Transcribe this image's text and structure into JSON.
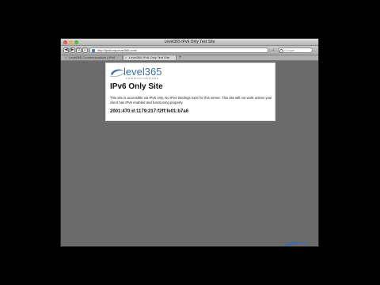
{
  "window": {
    "title": "Level365 IPv6 Only Test Site"
  },
  "toolbar": {
    "url": "http://ipv6only.level365.com/",
    "search_placeholder": "Google",
    "go_label": "→"
  },
  "tabs": [
    {
      "label": "Level365 Communications | IPv6"
    },
    {
      "label": "Level365 IPv6 Only Test Site"
    }
  ],
  "page": {
    "logo_text": "level365",
    "logo_subtext": "communications",
    "title": "IPv6 Only Site",
    "body": "This site is accessible via IPv6 only. No IPv4 bindings exist for this server. This site will not work unless your client has IPv6 enabled and functioning properly.",
    "address": "2001:470:d:1179:217:f2ff:fe01:b7a6"
  },
  "watermark": {
    "text": "level365"
  },
  "colors": {
    "brand_blue": "#3d6fa5",
    "page_background": "#6b6b6b",
    "outer_background": "#000000"
  }
}
